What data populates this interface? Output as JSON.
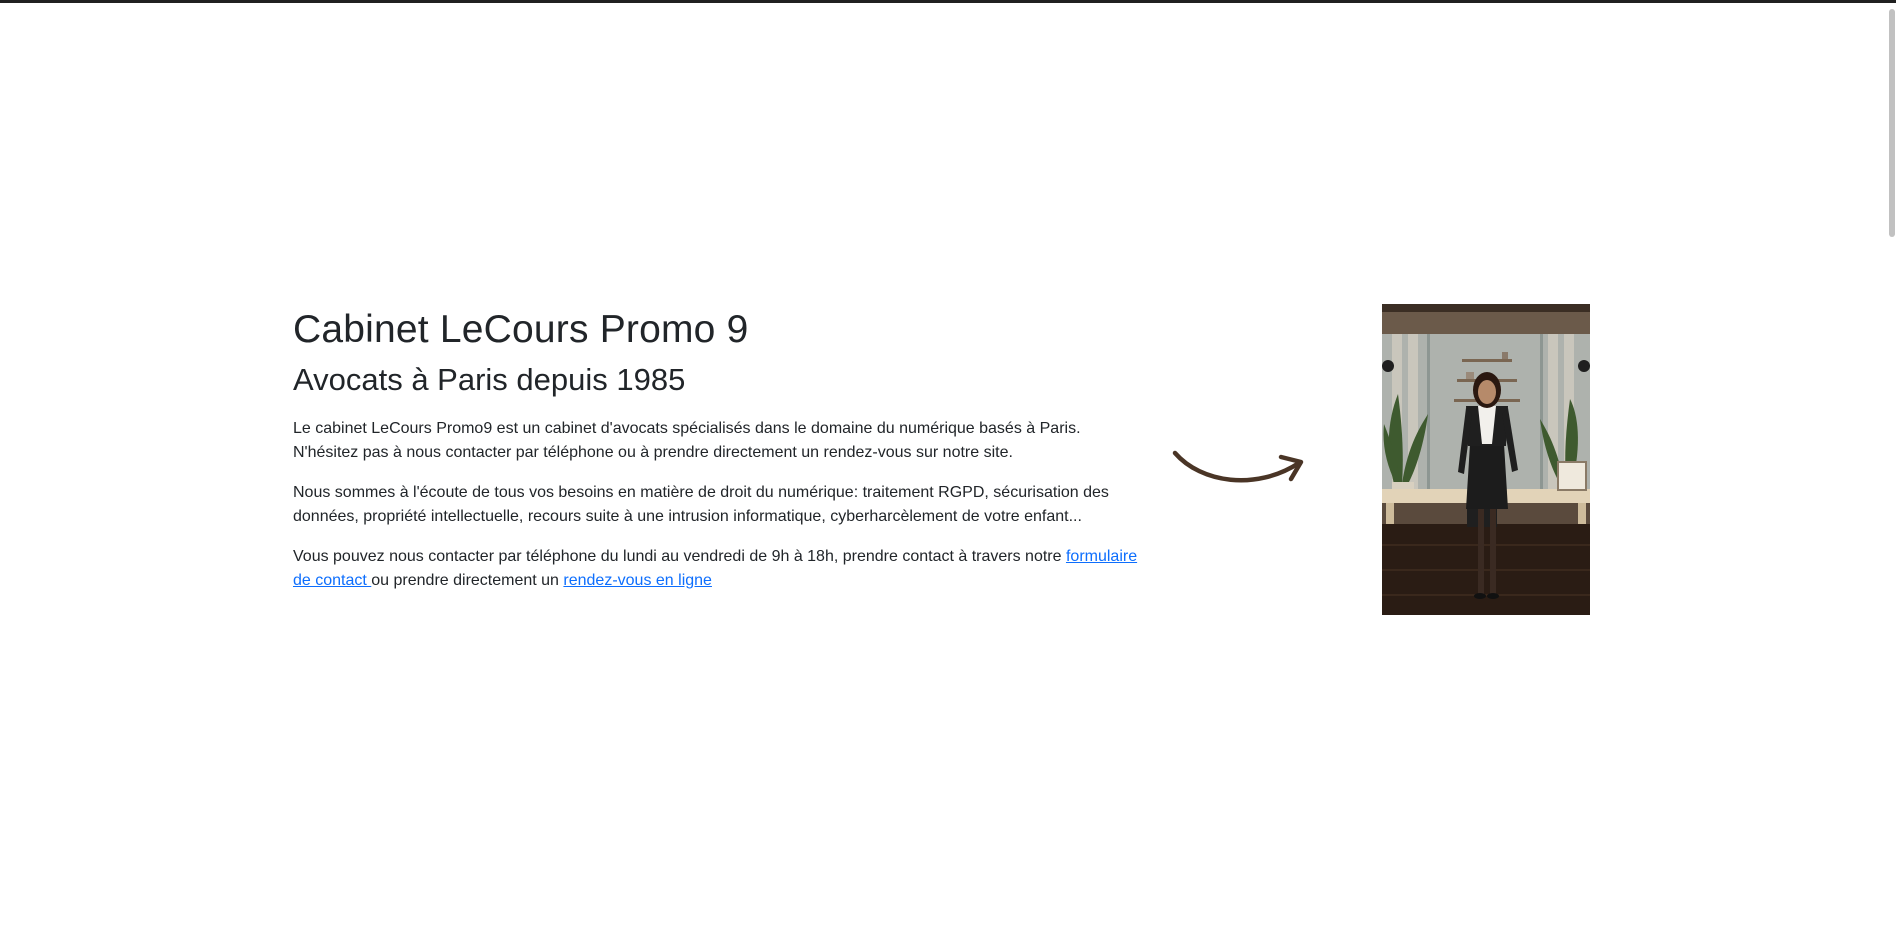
{
  "hero": {
    "title": "Cabinet LeCours Promo 9",
    "subtitle": "Avocats à Paris depuis 1985",
    "paragraph1": "Le cabinet LeCours Promo9 est un cabinet d'avocats spécialisés dans le domaine du numérique basés à Paris. N'hésitez pas à nous contacter par téléphone ou à prendre directement un rendez-vous sur notre site.",
    "paragraph2": "Nous sommes à l'écoute de tous vos besoins en matière de droit du numérique: traitement RGPD, sécurisation des données, propriété intellectuelle, recours suite à une intrusion informatique, cyberharcèlement de votre enfant...",
    "paragraph3_prefix": "Vous pouvez nous contacter par téléphone du lundi au vendredi de 9h à 18h, prendre contact à travers notre ",
    "contact_form_link": "formulaire de contact ",
    "paragraph3_middle": "ou prendre directement un ",
    "appointment_link": "rendez-vous en ligne"
  },
  "decoration": {
    "arrow_icon": "curved-arrow-right-icon",
    "arrow_color": "#4a3526"
  },
  "colors": {
    "text": "#212529",
    "link": "#0d6efd",
    "background": "#ffffff"
  }
}
